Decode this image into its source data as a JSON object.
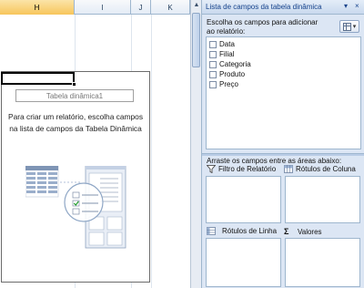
{
  "sheet": {
    "columns": [
      {
        "name": "H",
        "selected": true
      },
      {
        "name": "I",
        "selected": false
      },
      {
        "name": "J",
        "selected": false
      },
      {
        "name": "K",
        "selected": false
      }
    ],
    "pivot_name": "Tabela dinâmica1",
    "pivot_message": "Para criar um relatório, escolha campos na lista de campos da Tabela Dinâmica"
  },
  "panel": {
    "title": "Lista de campos da tabela dinâmica",
    "dropdown_glyph": "▾",
    "close_glyph": "×",
    "choose_label": "Escolha os campos para adicionar ao relatório:",
    "fields": [
      "Data",
      "Filial",
      "Categoria",
      "Produto",
      "Preço"
    ],
    "drag_label": "Arraste os campos entre as áreas abaixo:",
    "zones": {
      "report_filter": "Filtro de Relatório",
      "column_labels": "Rótulos de Coluna",
      "row_labels": "Rótulos de Linha",
      "values": "Valores"
    },
    "values_glyph": "Σ"
  },
  "colors": {
    "panel_bg": "#dce6f4",
    "accent": "#15428b",
    "selected_column": "#f7c55c"
  }
}
